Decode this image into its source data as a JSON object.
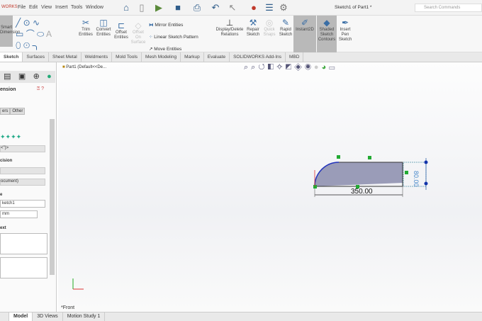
{
  "app": {
    "logo": "WORKS",
    "title": "Sketch1 of Part1 *",
    "search_placeholder": "Search Commands"
  },
  "menu": [
    "File",
    "Edit",
    "View",
    "Insert",
    "Tools",
    "Window"
  ],
  "ribbon": {
    "smart_dimension": "Smart Dimension",
    "trim": "Trim Entities",
    "convert": "Convert Entities",
    "offset": "Offset Entities",
    "offset_surface": "Offset On Surface",
    "mirror": "Mirror Entities",
    "linear_pattern": "Linear Sketch Pattern",
    "move": "Move Entities",
    "display_delete": "Display/Delete Relations",
    "repair": "Repair Sketch",
    "quick_snaps": "Quick Snaps",
    "rapid": "Rapid Sketch",
    "instant2d": "Instant2D",
    "shaded": "Shaded Sketch Contours",
    "insert_pen": "Insert Pen Sketch"
  },
  "tabs": [
    "Sketch",
    "Surfaces",
    "Sheet Metal",
    "Weldments",
    "Mold Tools",
    "Mesh Modeling",
    "Markup",
    "Evaluate",
    "SOLIDWORKS Add-Ins",
    "MBD"
  ],
  "panel": {
    "title": "ension",
    "subtabs": [
      "ers",
      "Other"
    ],
    "dropdown1": "<\")>",
    "section_precision": "cision",
    "dropdown_doc": "ocument)",
    "section_value": "e",
    "value_field": "ketch1",
    "unit_field": "mm",
    "section_text": "ext"
  },
  "tree": {
    "part": "Part1  (Default<<De..."
  },
  "sketch": {
    "width_dim": "350.00",
    "height_dim": "80.00"
  },
  "view_label": "*Front",
  "bottom_tabs": [
    "Model",
    "3D Views",
    "Motion Study 1"
  ]
}
